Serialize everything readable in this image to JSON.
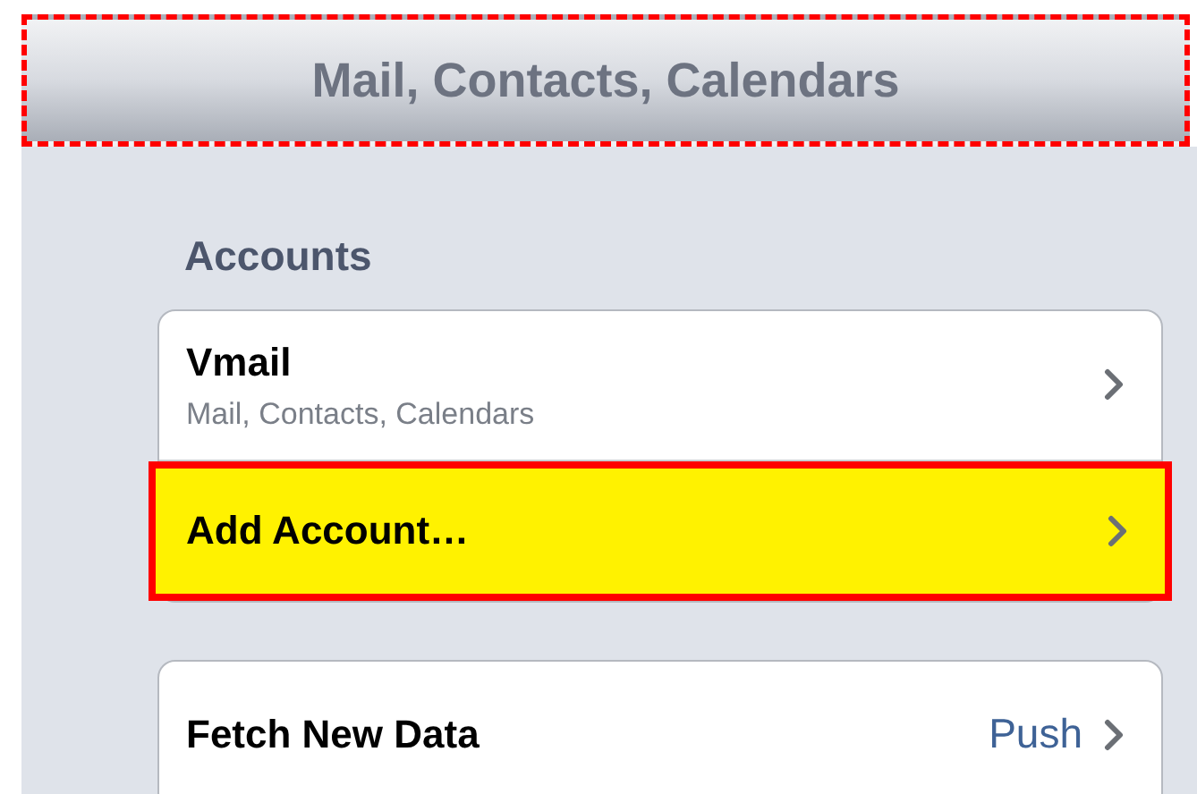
{
  "title_bar": {
    "title": "Mail, Contacts, Calendars",
    "highlighted": true
  },
  "accounts": {
    "heading": "Accounts",
    "rows": [
      {
        "label": "Vmail",
        "subtitle": "Mail, Contacts, Calendars",
        "highlighted": false
      },
      {
        "label": "Add Account…",
        "highlighted": true
      }
    ]
  },
  "fetch": {
    "label": "Fetch New Data",
    "value": "Push"
  }
}
